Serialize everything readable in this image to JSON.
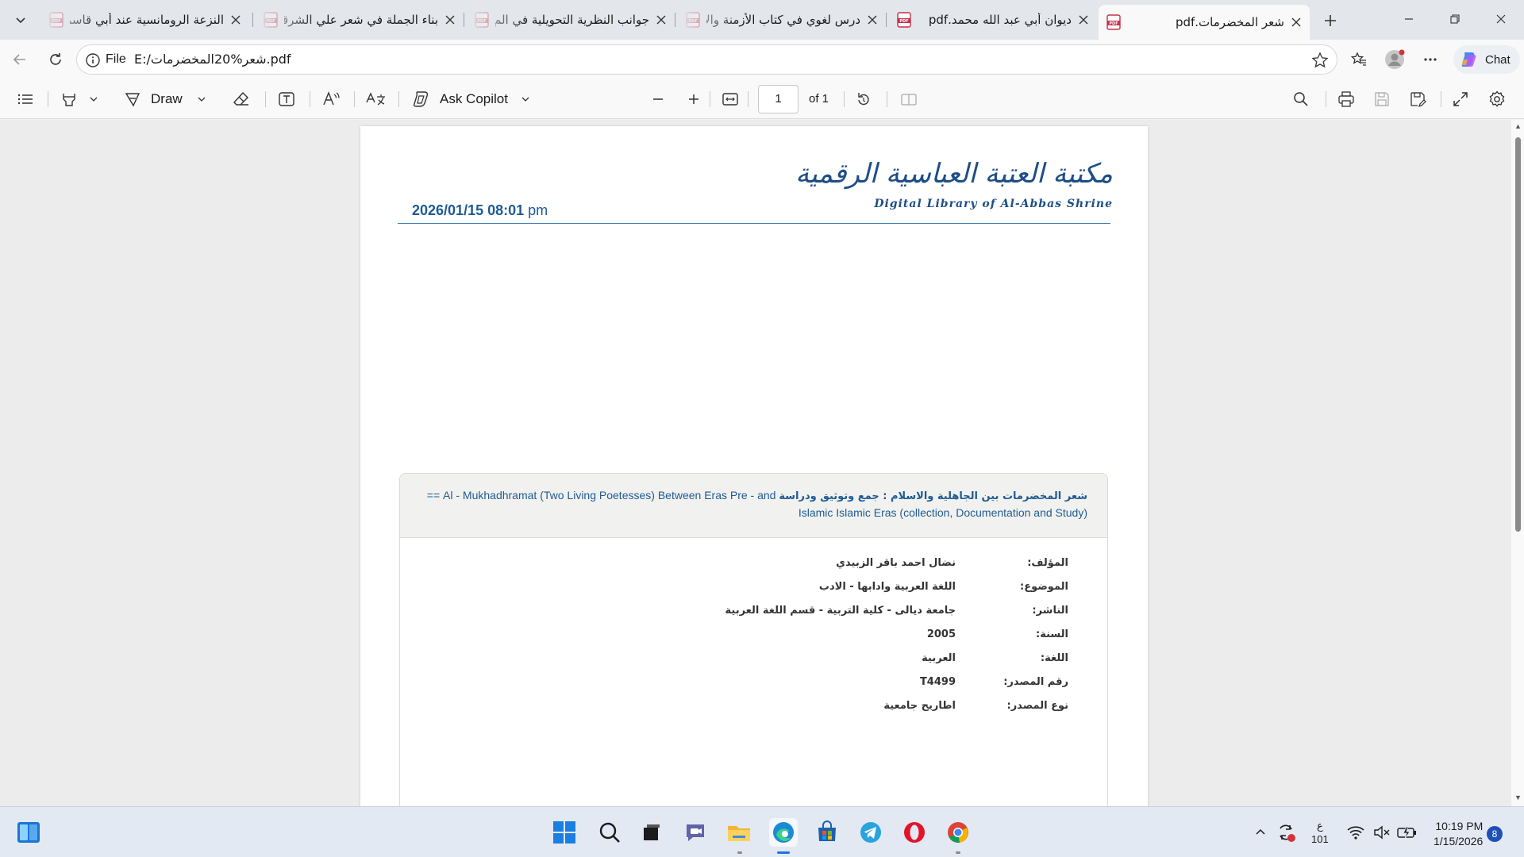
{
  "tabs": [
    {
      "title": "النزعة الرومانسية عند أبي قاسم",
      "active": false
    },
    {
      "title": "بناء الجملة في شعر علي الشرقي",
      "active": false
    },
    {
      "title": "جوانب النظرية التحويلية في الم",
      "active": false
    },
    {
      "title": "درس لغوي في كتاب الأزمنة والأ",
      "active": false
    },
    {
      "title": "ديوان أبي عبد الله محمد.pdf",
      "active": false
    },
    {
      "title": "شعر المخضرمات.pdf",
      "active": true
    }
  ],
  "address": {
    "scheme_label": "File",
    "url": "E:/شعر%20المخضرمات.pdf"
  },
  "chat_label": "Chat",
  "toolbar": {
    "draw_label": "Draw",
    "copilot_label": "Ask Copilot",
    "page_current": "1",
    "page_total": "of 1"
  },
  "document": {
    "date_bold": "2026/01/15 08:01",
    "date_suffix": "pm",
    "logo_arabic": "مكتبة العتبة العباسية الرقمية",
    "logo_english": "Digital Library of Al-Abbas Shrine",
    "title_ar": "شعر المخضرمات بين الجاهلية والاسلام : جمع وتوثيق ودراسة",
    "title_en": "== Al - Mukhadhramat (Two Living Poetesses) Between Eras Pre - and Islamic Islamic Eras (collection, Documentation and Study)",
    "fields": [
      {
        "label": "المؤلف:",
        "value": "نضال احمد باقر الزبيدي"
      },
      {
        "label": "الموضوع:",
        "value": "اللغة العربية وادابها - الادب"
      },
      {
        "label": "الناشر:",
        "value": "جامعة ديالى - كلية التربية - قسم اللغة العربية"
      },
      {
        "label": "السنة:",
        "value": "2005"
      },
      {
        "label": "اللغة:",
        "value": "العربية"
      },
      {
        "label": "رقم المصدر:",
        "value": "T4499"
      },
      {
        "label": "نوع المصدر:",
        "value": "اطاريح جامعية"
      }
    ]
  },
  "taskbar": {
    "lang_top": "ع",
    "lang_bottom": "101",
    "time": "10:19 PM",
    "date": "1/15/2026",
    "notifications": "8"
  }
}
